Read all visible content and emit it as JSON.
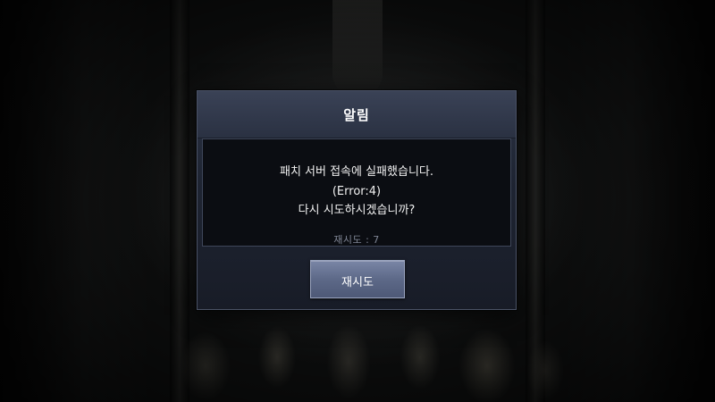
{
  "dialog": {
    "title": "알림",
    "message_lines": [
      "패치 서버 접속에 실패했습니다.",
      "(Error:4)",
      "다시 시도하시겠습니까?"
    ],
    "retry_count_text": "재시도 : 7",
    "retry_button_label": "재시도"
  },
  "colors": {
    "dialog_background": "#1f2533",
    "dialog_border": "#4a5266",
    "body_background": "#0b0d12",
    "button_accent": "#5d6988",
    "muted_text": "#7f8594"
  }
}
